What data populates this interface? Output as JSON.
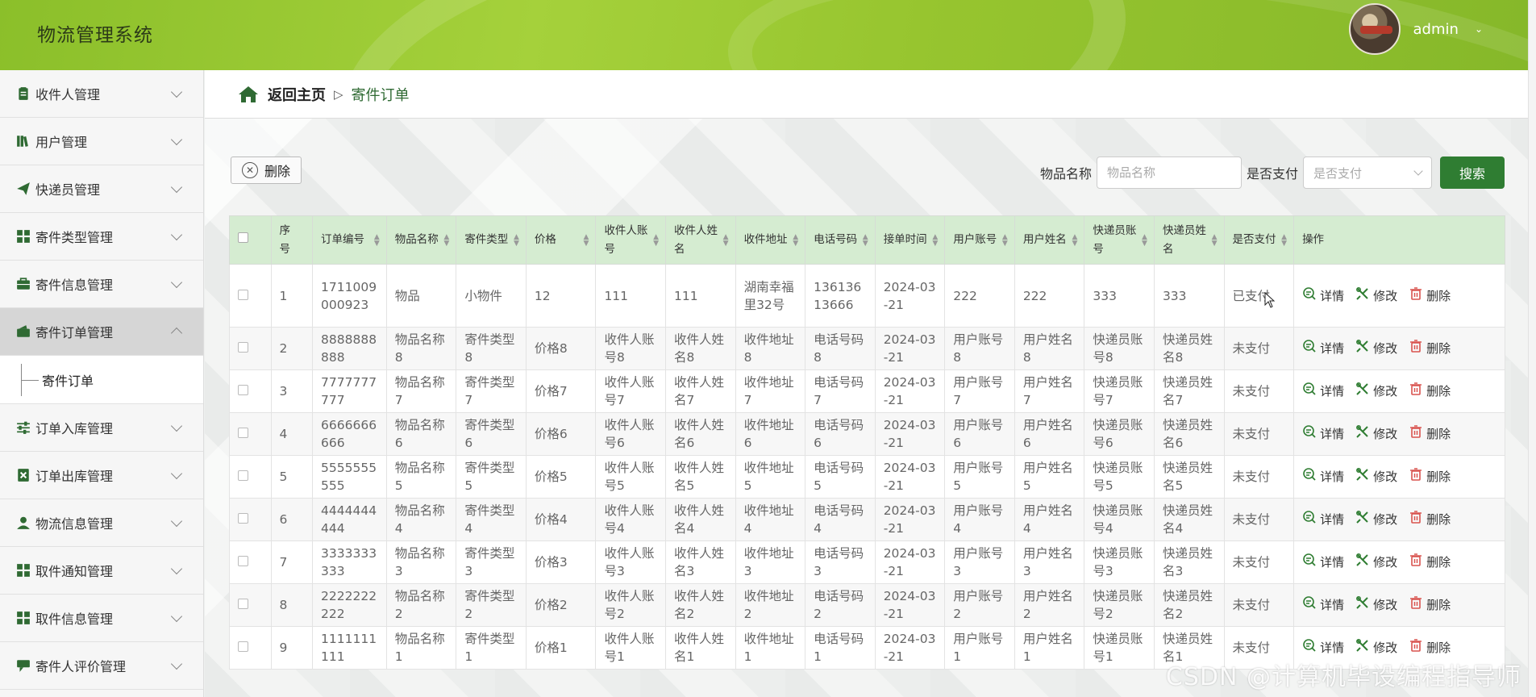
{
  "header": {
    "app_title": "物流管理系统",
    "user_name": "admin"
  },
  "sidebar": {
    "items": [
      {
        "label": "收件人管理",
        "icon": "clipboard-icon"
      },
      {
        "label": "用户管理",
        "icon": "books-icon"
      },
      {
        "label": "快递员管理",
        "icon": "paper-plane-icon"
      },
      {
        "label": "寄件类型管理",
        "icon": "grid-icon"
      },
      {
        "label": "寄件信息管理",
        "icon": "briefcase-icon"
      },
      {
        "label": "寄件订单管理",
        "icon": "wallet-icon"
      },
      {
        "label": "订单入库管理",
        "icon": "sliders-icon"
      },
      {
        "label": "订单出库管理",
        "icon": "cancel-box-icon"
      },
      {
        "label": "物流信息管理",
        "icon": "person-icon"
      },
      {
        "label": "取件通知管理",
        "icon": "grid-icon"
      },
      {
        "label": "取件信息管理",
        "icon": "grid-icon"
      },
      {
        "label": "寄件人评价管理",
        "icon": "comment-icon"
      }
    ],
    "active_submenu": "寄件订单"
  },
  "breadcrumb": {
    "home": "返回主页",
    "separator": "▷",
    "current": "寄件订单"
  },
  "toolbar": {
    "delete_label": "删除",
    "item_name_label": "物品名称",
    "item_name_placeholder": "物品名称",
    "paid_label": "是否支付",
    "paid_placeholder": "是否支付",
    "search_label": "搜索"
  },
  "table": {
    "headers": [
      "序号",
      "订单编号",
      "物品名称",
      "寄件类型",
      "价格",
      "收件人账号",
      "收件人姓名",
      "收件地址",
      "电话号码",
      "接单时间",
      "用户账号",
      "用户姓名",
      "快递员账号",
      "快递员姓名",
      "是否支付",
      "操作"
    ],
    "actions": {
      "detail": "详情",
      "edit": "修改",
      "delete": "删除"
    },
    "rows": [
      [
        "1",
        "1711009000923",
        "物品",
        "小物件",
        "12",
        "111",
        "111",
        "湖南幸福里32号",
        "13613613666",
        "2024-03-21",
        "222",
        "222",
        "333",
        "333",
        "已支付"
      ],
      [
        "2",
        "8888888888",
        "物品名称8",
        "寄件类型8",
        "价格8",
        "收件人账号8",
        "收件人姓名8",
        "收件地址8",
        "电话号码8",
        "2024-03-21",
        "用户账号8",
        "用户姓名8",
        "快递员账号8",
        "快递员姓名8",
        "未支付"
      ],
      [
        "3",
        "7777777777",
        "物品名称7",
        "寄件类型7",
        "价格7",
        "收件人账号7",
        "收件人姓名7",
        "收件地址7",
        "电话号码7",
        "2024-03-21",
        "用户账号7",
        "用户姓名7",
        "快递员账号7",
        "快递员姓名7",
        "未支付"
      ],
      [
        "4",
        "6666666666",
        "物品名称6",
        "寄件类型6",
        "价格6",
        "收件人账号6",
        "收件人姓名6",
        "收件地址6",
        "电话号码6",
        "2024-03-21",
        "用户账号6",
        "用户姓名6",
        "快递员账号6",
        "快递员姓名6",
        "未支付"
      ],
      [
        "5",
        "5555555555",
        "物品名称5",
        "寄件类型5",
        "价格5",
        "收件人账号5",
        "收件人姓名5",
        "收件地址5",
        "电话号码5",
        "2024-03-21",
        "用户账号5",
        "用户姓名5",
        "快递员账号5",
        "快递员姓名5",
        "未支付"
      ],
      [
        "6",
        "4444444444",
        "物品名称4",
        "寄件类型4",
        "价格4",
        "收件人账号4",
        "收件人姓名4",
        "收件地址4",
        "电话号码4",
        "2024-03-21",
        "用户账号4",
        "用户姓名4",
        "快递员账号4",
        "快递员姓名4",
        "未支付"
      ],
      [
        "7",
        "3333333333",
        "物品名称3",
        "寄件类型3",
        "价格3",
        "收件人账号3",
        "收件人姓名3",
        "收件地址3",
        "电话号码3",
        "2024-03-21",
        "用户账号3",
        "用户姓名3",
        "快递员账号3",
        "快递员姓名3",
        "未支付"
      ],
      [
        "8",
        "2222222222",
        "物品名称2",
        "寄件类型2",
        "价格2",
        "收件人账号2",
        "收件人姓名2",
        "收件地址2",
        "电话号码2",
        "2024-03-21",
        "用户账号2",
        "用户姓名2",
        "快递员账号2",
        "快递员姓名2",
        "未支付"
      ],
      [
        "9",
        "1111111111",
        "物品名称1",
        "寄件类型1",
        "价格1",
        "收件人账号1",
        "收件人姓名1",
        "收件地址1",
        "电话号码1",
        "2024-03-21",
        "用户账号1",
        "用户姓名1",
        "快递员账号1",
        "快递员姓名1",
        "未支付"
      ]
    ]
  },
  "watermark": "CSDN @计算机毕设编程指导师",
  "colors": {
    "header_green": "#9ccb35",
    "accent_green": "#2f7d32",
    "table_header_bg": "#d5ecd1"
  }
}
